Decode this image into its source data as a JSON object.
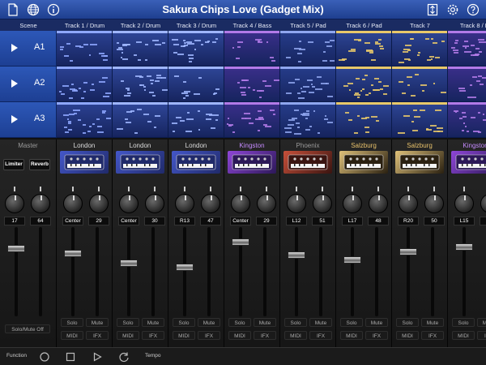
{
  "app": {
    "title": "Sakura Chips Love (Gadget Mix)"
  },
  "toolbar": {
    "left_icons": [
      "document-icon",
      "globe-icon",
      "info-icon"
    ],
    "right_icons": [
      "export-icon",
      "settings-icon",
      "help-icon"
    ]
  },
  "scene_header": "Scene",
  "scenes": [
    {
      "label": "A1"
    },
    {
      "label": "A2"
    },
    {
      "label": "A3"
    }
  ],
  "tracks": [
    {
      "header": "Track 1 / Drum",
      "color": "#8ea7ff",
      "bg": "#2c4294"
    },
    {
      "header": "Track 2 / Drum",
      "color": "#9fb6ff",
      "bg": "#30489b"
    },
    {
      "header": "Track 3 / Drum",
      "color": "#9fb6ff",
      "bg": "#2f4799"
    },
    {
      "header": "Track 4 / Bass",
      "color": "#b27ae8",
      "bg": "#3b2f8b"
    },
    {
      "header": "Track 5 / Pad",
      "color": "#8fa6ef",
      "bg": "#263d8b"
    },
    {
      "header": "Track 6 / Pad",
      "color": "#e8c86a",
      "bg": "#2e4696"
    },
    {
      "header": "Track 7",
      "color": "#e8c86a",
      "bg": "#2e4696"
    },
    {
      "header": "Track 8 / Le",
      "color": "#b27ae8",
      "bg": "#3b2f8b"
    }
  ],
  "mixer": {
    "master": {
      "name": "Master",
      "fx": [
        "Limiter",
        "Reverb"
      ],
      "values": [
        "17",
        "64"
      ],
      "solo_mute_off": "Solo/Mute Off",
      "fader_level": 0.78
    },
    "channels": [
      {
        "name": "London",
        "name_color": "#dcdcdc",
        "pan": "Center",
        "vol": "29",
        "gadget": "drum",
        "fader_level": 0.72
      },
      {
        "name": "London",
        "name_color": "#dcdcdc",
        "pan": "Center",
        "vol": "30",
        "gadget": "drum",
        "fader_level": 0.6
      },
      {
        "name": "London",
        "name_color": "#dcdcdc",
        "pan": "R13",
        "vol": "47",
        "gadget": "drum",
        "fader_level": 0.55
      },
      {
        "name": "Kingston",
        "name_color": "#c58bff",
        "pan": "Center",
        "vol": "29",
        "gadget": "kingston",
        "fader_level": 0.86
      },
      {
        "name": "Phoenix",
        "name_color": "#9a9a9a",
        "pan": "L12",
        "vol": "51",
        "gadget": "phoenix",
        "fader_level": 0.7
      },
      {
        "name": "Salzburg",
        "name_color": "#e6c06a",
        "pan": "L17",
        "vol": "48",
        "gadget": "salzburg",
        "fader_level": 0.64
      },
      {
        "name": "Salzburg",
        "name_color": "#e6c06a",
        "pan": "R20",
        "vol": "50",
        "gadget": "salzburg",
        "fader_level": 0.74
      },
      {
        "name": "Kingston",
        "name_color": "#c58bff",
        "pan": "L15",
        "vol": "",
        "gadget": "kingston",
        "fader_level": 0.8
      }
    ],
    "labels": {
      "solo": "Solo",
      "mute": "Mute",
      "midi": "MIDI",
      "ifx": "IFX"
    }
  },
  "bottom_bar": {
    "function_label": "Function",
    "tempo_label": "Tempo",
    "icons": [
      "record-icon",
      "stop-icon",
      "play-icon",
      "loop-icon"
    ]
  }
}
